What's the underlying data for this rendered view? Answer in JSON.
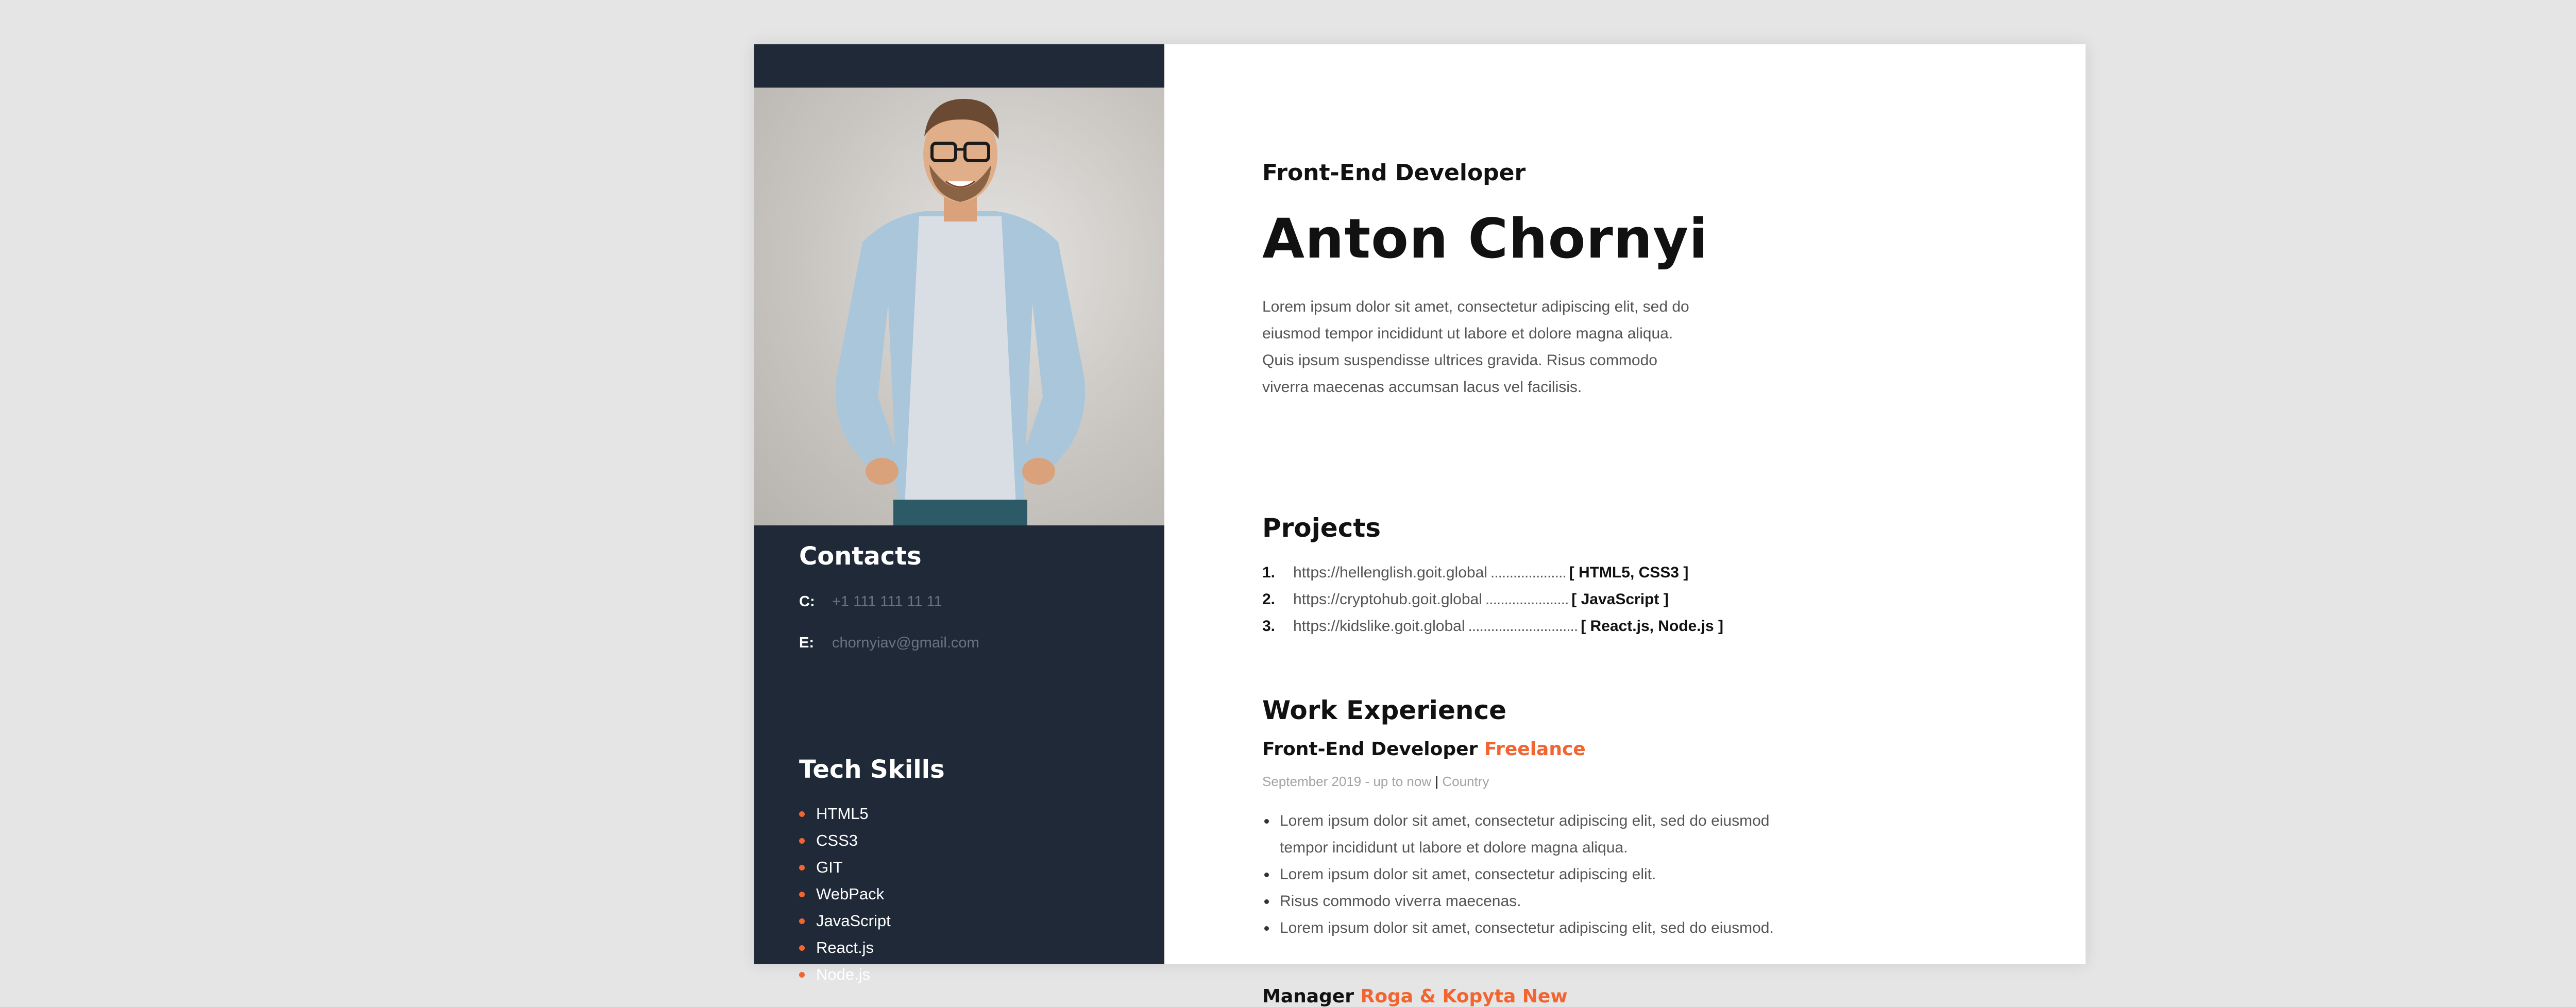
{
  "profile": {
    "role": "Front-End Developer",
    "name": "Anton Chornyi",
    "about": "Lorem ipsum dolor sit amet, consectetur adipiscing elit, sed do eiusmod tempor incididunt ut labore et dolore magna aliqua. Quis ipsum suspendisse ultrices gravida. Risus commodo viverra maecenas accumsan lacus vel facilisis."
  },
  "sidebar": {
    "contacts_title": "Contacts",
    "contacts": [
      {
        "key": "C:",
        "value": "+1 111 111 11 11"
      },
      {
        "key": "E:",
        "value": "chornyiav@gmail.com"
      }
    ],
    "skills_title": "Tech Skills",
    "skills": [
      "HTML5",
      "CSS3",
      "GIT",
      "WebPack",
      "JavaScript",
      "React.js",
      "Node.js"
    ]
  },
  "projects": {
    "title": "Projects",
    "items": [
      {
        "num": "1.",
        "url": "https://hellenglish.goit.global",
        "dots": "....................",
        "tech": "[ HTML5, CSS3 ]"
      },
      {
        "num": "2.",
        "url": "https://cryptohub.goit.global",
        "dots": "......................",
        "tech": "[ JavaScript ]"
      },
      {
        "num": "3.",
        "url": "https://kidslike.goit.global",
        "dots": ".............................",
        "tech": "[ React.js, Node.js ]"
      }
    ]
  },
  "experience": {
    "title": "Work Experience",
    "jobs": [
      {
        "position": "Front-End Developer",
        "company": "Freelance",
        "period": "September 2019 - up to now",
        "separator": "|",
        "location": "Country",
        "duties": [
          "Lorem ipsum dolor sit amet, consectetur adipiscing elit, sed do eiusmod tempor incididunt ut labore et dolore magna aliqua.",
          "Lorem ipsum dolor sit amet, consectetur adipiscing elit.",
          "Risus commodo viverra maecenas.",
          "Lorem ipsum dolor sit amet, consectetur adipiscing elit, sed do eiusmod."
        ]
      },
      {
        "position": "Manager",
        "company": "Roga & Kopyta New"
      }
    ]
  },
  "colors": {
    "sidebar": "#1f2937",
    "accent": "#f26430",
    "page": "#ffffff",
    "background": "#e5e5e5"
  }
}
